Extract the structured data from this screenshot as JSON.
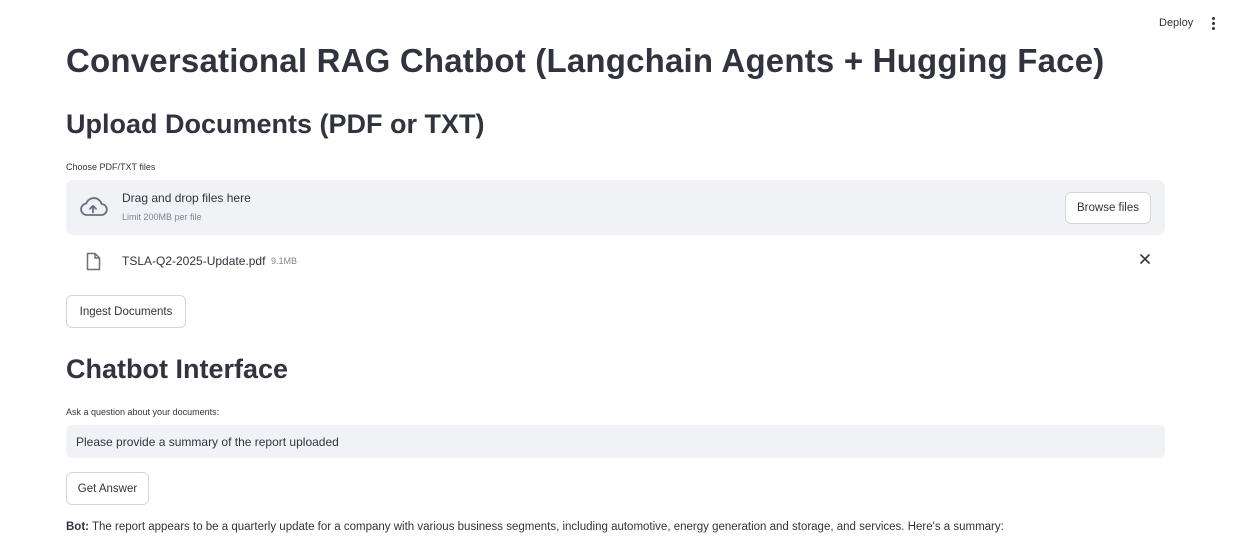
{
  "header": {
    "deploy_label": "Deploy",
    "menu_icon": "vertical-ellipsis-icon"
  },
  "page": {
    "title": "Conversational RAG Chatbot (Langchain Agents + Hugging Face)"
  },
  "upload": {
    "heading": "Upload Documents (PDF or TXT)",
    "field_label": "Choose PDF/TXT files",
    "dropzone_title": "Drag and drop files here",
    "dropzone_limit": "Limit 200MB per file",
    "browse_label": "Browse files",
    "dropzone_icon": "cloud-upload-icon",
    "file": {
      "name": "TSLA-Q2-2025-Update.pdf",
      "size": "9.1MB",
      "icon": "file-icon"
    },
    "ingest_label": "Ingest Documents"
  },
  "chat": {
    "heading": "Chatbot Interface",
    "question_label": "Ask a question about your documents:",
    "question_value": "Please provide a summary of the report uploaded",
    "answer_button_label": "Get Answer",
    "bot_prefix": "Bot:",
    "bot_text": "The report appears to be a quarterly update for a company with various business segments, including automotive, energy generation and storage, and services. Here's a summary:"
  },
  "colors": {
    "text": "#31333f",
    "muted": "#808495",
    "input_bg": "#f0f2f6",
    "border": "#d6d6d9"
  }
}
